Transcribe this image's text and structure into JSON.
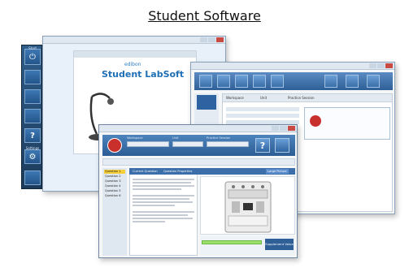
{
  "heading": "Student Software",
  "launcher": {
    "items": [
      {
        "label": "Start",
        "icon": "power-icon",
        "glyph": "⏻"
      },
      {
        "label": "",
        "icon": "list-icon",
        "glyph": ""
      },
      {
        "label": "",
        "icon": "exercise-icon",
        "glyph": ""
      },
      {
        "label": "",
        "icon": "results-icon",
        "glyph": ""
      },
      {
        "label": "",
        "icon": "help-icon",
        "glyph": "?"
      },
      {
        "label": "Settings",
        "icon": "settings-icon",
        "glyph": "⚙"
      },
      {
        "label": "",
        "icon": "exit-icon",
        "glyph": ""
      }
    ]
  },
  "splash": {
    "brand": "edibon",
    "title": "Student LabSoft"
  },
  "main_window": {
    "columns": [
      "Workspace",
      "Unit",
      "Practice Session"
    ],
    "question_label": ""
  },
  "exercise_window": {
    "fields": [
      "Workspace",
      "Unit",
      "Practice Session"
    ],
    "questions": [
      "Question 1",
      "Question 2",
      "Question 3",
      "Question 4",
      "Question 5",
      "Question 6"
    ],
    "tabs": [
      "Current Question",
      "Question Properties"
    ],
    "large_picture": "Large Picture",
    "supplement": "Supplement Value",
    "answer_label": "",
    "help_glyph": "?"
  },
  "colors": {
    "accent": "#2f5f97",
    "brand_red": "#c9302c",
    "highlight": "#f5cf3a",
    "success": "#9be06b"
  }
}
